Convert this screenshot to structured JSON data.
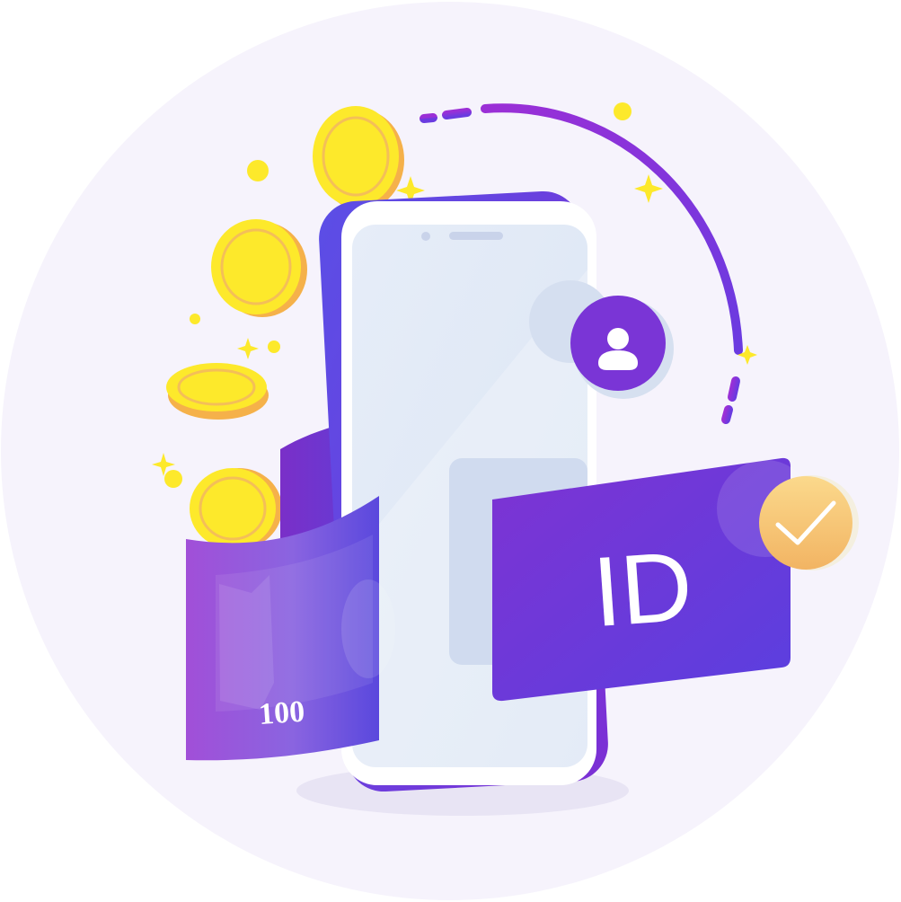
{
  "illustration": {
    "id_card": {
      "label": "ID"
    },
    "banknote": {
      "value": "100"
    },
    "icons": [
      "user-icon",
      "checkmark-icon",
      "coin-icon",
      "sparkle-icon",
      "smartphone-icon"
    ],
    "colors": {
      "background_circle": "#f6f3fc",
      "purple": "#7a35d6",
      "violet": "#5b3fe0",
      "coin_yellow": "#fde92b",
      "coin_shadow": "#f5b14a",
      "phone_screen": "#e2eaf7",
      "check_badge": "#f7c46a",
      "white": "#ffffff"
    }
  }
}
